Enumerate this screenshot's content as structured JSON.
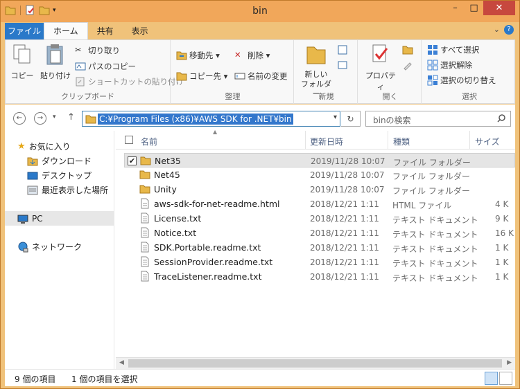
{
  "window": {
    "title": "bin"
  },
  "title_controls": {
    "minimize": "–",
    "maximize": "□",
    "close": "✕"
  },
  "tabs": [
    {
      "label": "ファイル"
    },
    {
      "label": "ホーム"
    },
    {
      "label": "共有"
    },
    {
      "label": "表示"
    }
  ],
  "ribbon": {
    "clipboard": {
      "label": "クリップボード",
      "copy": "コピー",
      "paste": "貼り付け",
      "cut": "切り取り",
      "copy_path": "パスのコピー",
      "paste_shortcut": "ショートカットの貼り付け"
    },
    "organize": {
      "label": "整理",
      "move_to": "移動先 ▾",
      "copy_to": "コピー先 ▾",
      "delete": "削除 ▾",
      "rename": "名前の変更"
    },
    "new": {
      "label": "新規",
      "new_folder": "新しい\nフォルダー"
    },
    "open": {
      "label": "開く",
      "properties": "プロパティ"
    },
    "select": {
      "label": "選択",
      "select_all": "すべて選択",
      "select_none": "選択解除",
      "invert": "選択の切り替え"
    }
  },
  "address": {
    "path": "C:¥Program Files (x86)¥AWS SDK for .NET¥bin",
    "search_placeholder": "binの検索"
  },
  "nav_pane": {
    "favorites": "お気に入り",
    "downloads": "ダウンロード",
    "desktop": "デスクトップ",
    "recent": "最近表示した場所",
    "pc": "PC",
    "network": "ネットワーク"
  },
  "columns": {
    "name": "名前",
    "date": "更新日時",
    "type": "種類",
    "size": "サイズ"
  },
  "files": [
    {
      "name": "Net35",
      "date": "2019/11/28 10:07",
      "type": "ファイル フォルダー",
      "size": "",
      "kind": "folder",
      "selected": true
    },
    {
      "name": "Net45",
      "date": "2019/11/28 10:07",
      "type": "ファイル フォルダー",
      "size": "",
      "kind": "folder"
    },
    {
      "name": "Unity",
      "date": "2019/11/28 10:07",
      "type": "ファイル フォルダー",
      "size": "",
      "kind": "folder"
    },
    {
      "name": "aws-sdk-for-net-readme.html",
      "date": "2018/12/21 1:11",
      "type": "HTML ファイル",
      "size": "4 K",
      "kind": "html"
    },
    {
      "name": "License.txt",
      "date": "2018/12/21 1:11",
      "type": "テキスト ドキュメント",
      "size": "9 K",
      "kind": "txt"
    },
    {
      "name": "Notice.txt",
      "date": "2018/12/21 1:11",
      "type": "テキスト ドキュメント",
      "size": "16 K",
      "kind": "txt"
    },
    {
      "name": "SDK.Portable.readme.txt",
      "date": "2018/12/21 1:11",
      "type": "テキスト ドキュメント",
      "size": "1 K",
      "kind": "txt"
    },
    {
      "name": "SessionProvider.readme.txt",
      "date": "2018/12/21 1:11",
      "type": "テキスト ドキュメント",
      "size": "1 K",
      "kind": "txt"
    },
    {
      "name": "TraceListener.readme.txt",
      "date": "2018/12/21 1:11",
      "type": "テキスト ドキュメント",
      "size": "1 K",
      "kind": "txt"
    }
  ],
  "status": {
    "count": "9 個の項目",
    "selected": "1 個の項目を選択"
  },
  "colors": {
    "accent": "#2a79c9",
    "title_bar": "#f1a75a",
    "folder": "#e8b84a",
    "close": "#c7483e"
  }
}
